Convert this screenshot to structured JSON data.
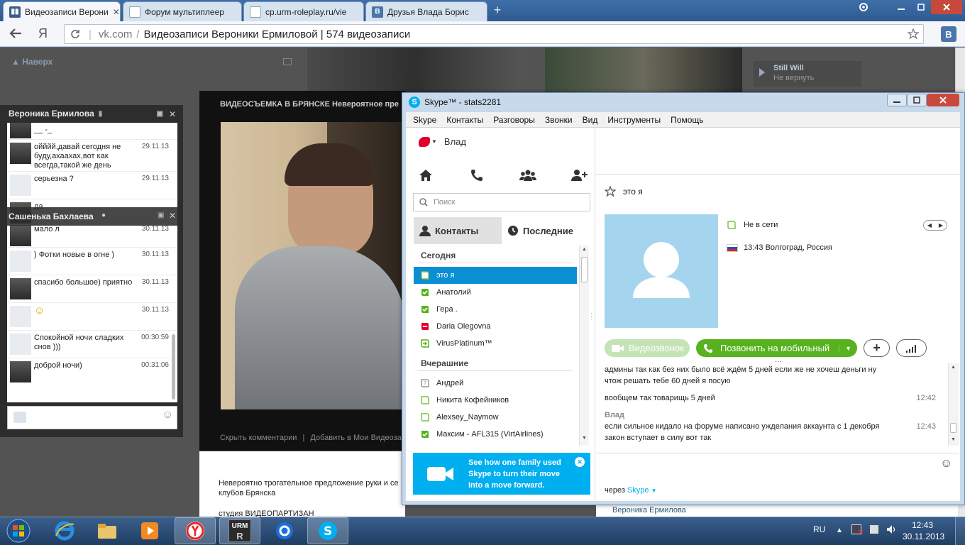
{
  "browser": {
    "tabs": [
      {
        "title": "Видеозаписи Верони",
        "favicon": "vk-video-icon",
        "active": true
      },
      {
        "title": "Форум мультиплеер",
        "favicon": "page-icon",
        "active": false
      },
      {
        "title": "cp.urm-roleplay.ru/vie",
        "favicon": "page-icon",
        "active": false
      },
      {
        "title": "Друзья Влада Борис",
        "favicon": "vk-icon",
        "active": false
      }
    ],
    "address": {
      "host": "vk.com",
      "separator": "/",
      "page_title": "Видеозаписи Вероники Ермиловой | 574 видеозаписи"
    },
    "yandex_glyph": "Я",
    "vk_ext_label": "В"
  },
  "vk_page": {
    "nav_up": "Наверх",
    "video_title": "ВИДЕОСЪЕМКА В БРЯНСКЕ Невероятное пре",
    "video_links": {
      "hide": "Скрыть комментарии",
      "sep": "|",
      "add": "Добавить в Мои Видеозапи"
    },
    "description": "Невероятно трогательное предложение руки и се клубов Брянска",
    "studio": "студия ВИДЕОПАРТИЗАН",
    "right_user": "Вероника Ермилова",
    "side_song": {
      "artist": "Still Will",
      "track": "Не вернуть"
    }
  },
  "chat": {
    "header": "Вероника Ермилова",
    "header2": "Сашенька Бахлаева",
    "messages": [
      {
        "text": "__ -_",
        "time": "",
        "avatar": "photo"
      },
      {
        "text": "ойййй,давай сегодня не буду,ахаахах,вот как всегда,такой же день",
        "time": "29.11.13",
        "avatar": "photo"
      },
      {
        "text": "серьезна ?",
        "time": "29.11.13",
        "avatar": "camera"
      },
      {
        "text": "да",
        "time": "",
        "avatar": "photo"
      },
      {
        "text": "мало л",
        "time": "30.11.13",
        "avatar": "photo"
      },
      {
        "text": ") Фотки новые в огне )",
        "time": "30.11.13",
        "avatar": "camera"
      },
      {
        "text": "спасибо большое) приятно",
        "time": "30.11.13",
        "avatar": "photo"
      },
      {
        "text": "☺",
        "time": "30.11.13",
        "avatar": "camera"
      },
      {
        "text": "Спокойной ночи сладких снов )))",
        "time": "00:30:59",
        "avatar": "camera"
      },
      {
        "text": "доброй ночи)",
        "time": "00:31:06",
        "avatar": "photo"
      }
    ]
  },
  "skype": {
    "title": "Skype™ - stats2281",
    "menu": [
      "Skype",
      "Контакты",
      "Разговоры",
      "Звонки",
      "Вид",
      "Инструменты",
      "Помощь"
    ],
    "user": "Влад",
    "search_placeholder": "Поиск",
    "tabs": {
      "contacts": "Контакты",
      "recent": "Последние"
    },
    "sections": {
      "today": "Сегодня",
      "yesterday": "Вчерашние"
    },
    "today": [
      {
        "name": "это я",
        "status": "offline",
        "selected": true
      },
      {
        "name": "Анатолий",
        "status": "online"
      },
      {
        "name": "Гера .",
        "status": "online"
      },
      {
        "name": "Daria Olegovna",
        "status": "busy"
      },
      {
        "name": "VirusPlatinum™",
        "status": "forward"
      }
    ],
    "yesterday": [
      {
        "name": "Андрей",
        "status": "unknown"
      },
      {
        "name": "Никита Кофейников",
        "status": "offline"
      },
      {
        "name": "Alexsey_Naymow",
        "status": "offline"
      },
      {
        "name": "Максим - AFL315 (VirtAirlines)",
        "status": "online"
      }
    ],
    "promo": "See how one family used Skype to turn their move into a move forward.",
    "profile": {
      "name": "это я",
      "status": "Не в сети",
      "location": "13:43 Волгоград, Россия"
    },
    "buttons": {
      "video": "Видеозвонок",
      "call": "Позвонить на мобильный",
      "add": "+"
    },
    "conversation": [
      {
        "sender": "",
        "text": "админы так как без них было всё ждём 5 дней если же не хочеш деньги ну чтож решать тебе 60 дней я посую",
        "time": ""
      },
      {
        "sender": "",
        "text": "вообщем так товарищь 5 дней",
        "time": "12:42"
      },
      {
        "sender": "Влад",
        "text": "если сильное кидало на форуме написано ужделания аккаунта с 1 декобря закон вступает в силу вот так",
        "time": "12:43"
      }
    ],
    "via": {
      "prefix": "через",
      "service": "Skype"
    },
    "colors": {
      "accent": "#00aff0",
      "online": "#57b21e",
      "busy": "#e0002a"
    }
  },
  "taskbar": {
    "lang": "RU",
    "time": "12:43",
    "date": "30.11.2013",
    "urm_label": "URM"
  }
}
